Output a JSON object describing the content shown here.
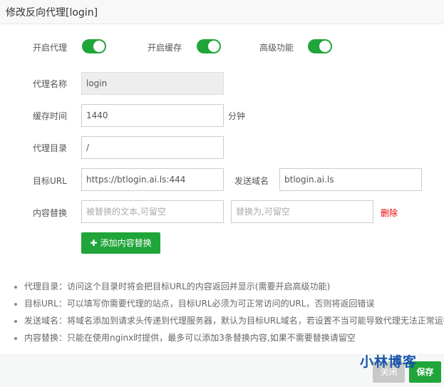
{
  "title": "修改反向代理[login]",
  "toggles": [
    {
      "label": "开启代理",
      "on": true
    },
    {
      "label": "开启缓存",
      "on": true
    },
    {
      "label": "高级功能",
      "on": true
    }
  ],
  "form": {
    "name_label": "代理名称",
    "name_value": "login",
    "cache_label": "缓存时间",
    "cache_value": "1440",
    "cache_unit": "分钟",
    "dir_label": "代理目录",
    "dir_value": "/",
    "url_label": "目标URL",
    "url_value": "https://btlogin.ai.ls:444",
    "domain_label": "发送域名",
    "domain_value": "btlogin.ai.ls",
    "replace_label": "内容替换",
    "replace_from_placeholder": "被替换的文本,可留空",
    "replace_to_placeholder": "替换为,可留空",
    "delete_label": "删除",
    "add_replace_label": "添加内容替换"
  },
  "tips": [
    "代理目录：访问这个目录时将会把目标URL的内容返回并显示(需要开启高级功能)",
    "目标URL：可以填写你需要代理的站点，目标URL必须为可正常访问的URL，否则将返回错误",
    "发送域名：将域名添加到请求头传递到代理服务器，默认为目标URL域名，若设置不当可能导致代理无法正常运行",
    "内容替换：只能在使用nginx时提供，最多可以添加3条替换内容,如果不需要替换请留空"
  ],
  "watermark": "小林博客",
  "footer": {
    "close_label": "关闭",
    "save_label": "保存"
  },
  "colors": {
    "accent": "#20a53a",
    "danger": "#e00",
    "close": "#c9c9c9"
  }
}
